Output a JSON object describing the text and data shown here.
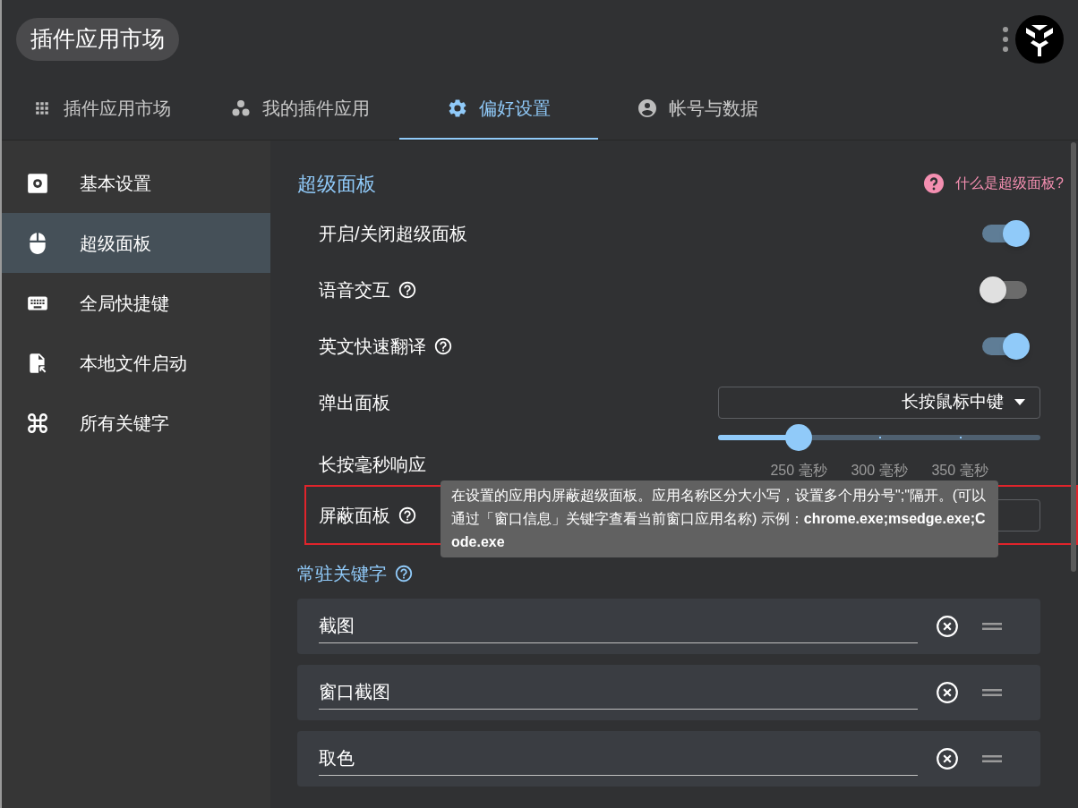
{
  "header": {
    "title": "插件应用市场"
  },
  "tabs": [
    {
      "label": "插件应用市场",
      "selected": false
    },
    {
      "label": "我的插件应用",
      "selected": false
    },
    {
      "label": "偏好设置",
      "selected": true
    },
    {
      "label": "帐号与数据",
      "selected": false
    }
  ],
  "sidebar": {
    "items": [
      {
        "label": "基本设置",
        "selected": false
      },
      {
        "label": "超级面板",
        "selected": true
      },
      {
        "label": "全局快捷键",
        "selected": false
      },
      {
        "label": "本地文件启动",
        "selected": false
      },
      {
        "label": "所有关键字",
        "selected": false
      }
    ]
  },
  "section": {
    "title": "超级面板",
    "help_link": "什么是超级面板?"
  },
  "settings": [
    {
      "kind": "switch",
      "label": "开启/关闭超级面板",
      "help": false,
      "on": true
    },
    {
      "kind": "switch",
      "label": "语音交互",
      "help": true,
      "on": false
    },
    {
      "kind": "switch",
      "label": "英文快速翻译",
      "help": true,
      "on": true
    },
    {
      "kind": "select",
      "label": "弹出面板",
      "help": false,
      "value": "长按鼠标中键"
    },
    {
      "kind": "slider",
      "label": "长按毫秒响应",
      "help": false,
      "level": 0.25,
      "marks": [
        "250 毫秒",
        "300 毫秒",
        "350 毫秒"
      ]
    },
    {
      "kind": "input",
      "label": "屏蔽面板",
      "help": true,
      "highlighted": true,
      "tooltip": "在设置的应用内屏蔽超级面板。应用名称区分大小写，设置多个用分号\";\"隔开。(可以通过「窗口信息」关键字查看当前窗口应用名称) 示例：**chrome.exe;msedge.exe;Code.exe**"
    }
  ],
  "keywords": {
    "title": "常驻关键字",
    "items": [
      "截图",
      "窗口截图",
      "取色"
    ]
  }
}
